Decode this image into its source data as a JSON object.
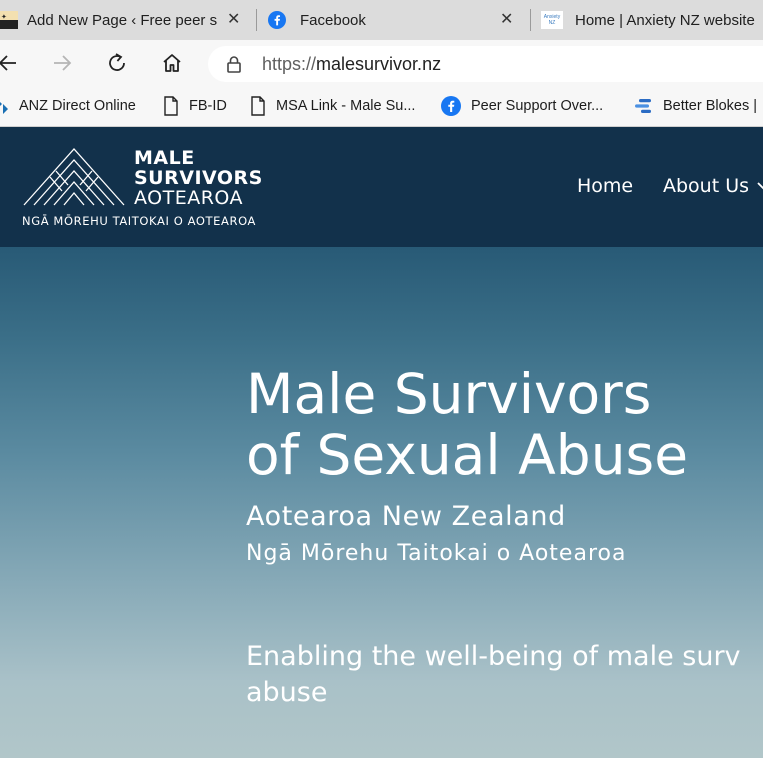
{
  "tabs": [
    {
      "title": "Add New Page ‹ Free peer support",
      "favicon": "blog-favicon-icon",
      "close": "✕"
    },
    {
      "title": "Facebook",
      "favicon": "facebook-icon",
      "close": "✕"
    },
    {
      "title": "Home | Anxiety NZ website",
      "favicon": "anxiety-nz-favicon-icon",
      "favicon_text": "Anxiety NZ"
    }
  ],
  "addressbar": {
    "scheme": "https://",
    "host": "malesurvivor.nz"
  },
  "bookmarks": [
    {
      "label": "ANZ Direct Online",
      "icon": "anz-icon"
    },
    {
      "label": "FB-ID",
      "icon": "page-icon"
    },
    {
      "label": "MSA Link - Male Su...",
      "icon": "page-icon"
    },
    {
      "label": "Peer Support Over...",
      "icon": "facebook-icon"
    },
    {
      "label": "Better Blokes |",
      "icon": "better-blokes-icon"
    }
  ],
  "site": {
    "brand": {
      "line1": "MALE",
      "line2": "SURVIVORS",
      "line3": "AOTEAROA",
      "sub": "NGĀ MŌREHU TAITOKAI O AOTEAROA"
    },
    "menu": [
      {
        "label": "Home"
      },
      {
        "label": "About Us"
      }
    ],
    "hero": {
      "title_line1": "Male Survivors",
      "title_line2": "of Sexual Abuse",
      "subtitle": "Aotearoa New Zealand",
      "subtitle_maori": "Ngā Mōrehu Taitokai o Aotearoa",
      "tagline_line1": "Enabling the well-being of male surv",
      "tagline_line2": "abuse"
    }
  },
  "colors": {
    "header_bg": "#12314b",
    "facebook": "#1877f2",
    "tabbar": "#dcdcdc"
  }
}
